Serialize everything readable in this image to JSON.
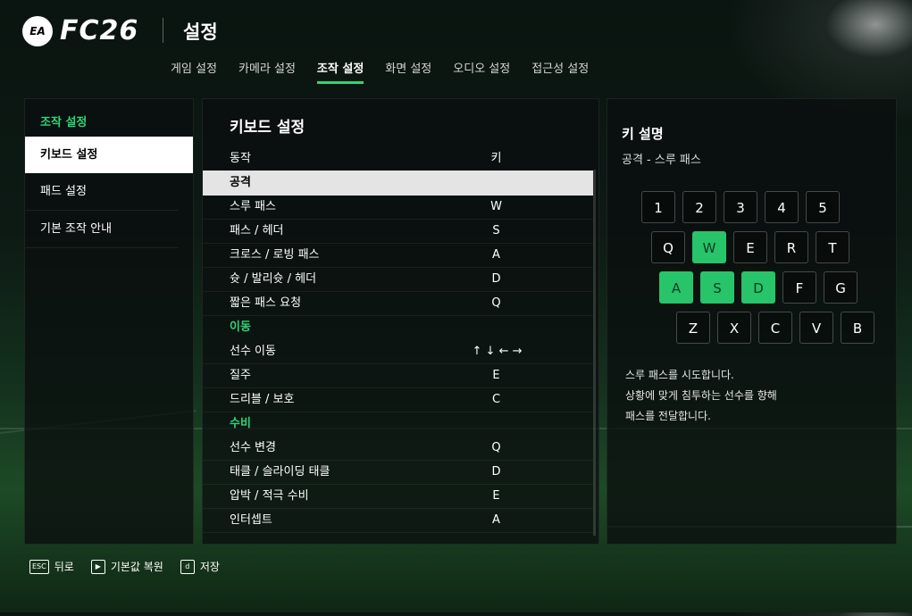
{
  "brand": {
    "ea": "EA",
    "game": "FC26"
  },
  "page_title": "설정",
  "tabs": [
    {
      "label": "게임 설정",
      "active": false
    },
    {
      "label": "카메라 설정",
      "active": false
    },
    {
      "label": "조작 설정",
      "active": true
    },
    {
      "label": "화면 설정",
      "active": false
    },
    {
      "label": "오디오 설정",
      "active": false
    },
    {
      "label": "접근성 설정",
      "active": false
    }
  ],
  "sidebar": {
    "header": "조작 설정",
    "items": [
      {
        "label": "키보드 설정",
        "selected": true
      },
      {
        "label": "패드 설정",
        "selected": false
      },
      {
        "label": "기본 조작 안내",
        "selected": false
      }
    ]
  },
  "keyboard": {
    "title": "키보드 설정",
    "col_action": "동작",
    "col_key": "키",
    "rows": [
      {
        "type": "section-item",
        "label": "공격",
        "key": "",
        "highlighted": true
      },
      {
        "type": "item",
        "label": "스루 패스",
        "key": "W"
      },
      {
        "type": "item",
        "label": "패스 / 헤더",
        "key": "S"
      },
      {
        "type": "item",
        "label": "크로스 / 로빙 패스",
        "key": "A"
      },
      {
        "type": "item",
        "label": "슛 / 발리슛 / 헤더",
        "key": "D"
      },
      {
        "type": "item",
        "label": "짧은 패스 요청",
        "key": "Q"
      },
      {
        "type": "section",
        "label": "이동"
      },
      {
        "type": "item",
        "label": "선수 이동",
        "key": "↑ ↓ ← →"
      },
      {
        "type": "item",
        "label": "질주",
        "key": "E"
      },
      {
        "type": "item",
        "label": "드리블 / 보호",
        "key": "C"
      },
      {
        "type": "section",
        "label": "수비"
      },
      {
        "type": "item",
        "label": "선수 변경",
        "key": "Q"
      },
      {
        "type": "item",
        "label": "태클 / 슬라이딩 태클",
        "key": "D"
      },
      {
        "type": "item",
        "label": "압박 / 적극 수비",
        "key": "E"
      },
      {
        "type": "item",
        "label": "인터셉트",
        "key": "A"
      }
    ]
  },
  "description": {
    "title": "키 설명",
    "subtitle": "공격 - 스루 패스",
    "lines": [
      "스루 패스를 시도합니다.",
      "상황에 맞게 침투하는 선수를 향해",
      "패스를 전달합니다."
    ]
  },
  "keymap": {
    "rows": [
      [
        "1",
        "2",
        "3",
        "4",
        "5"
      ],
      [
        "Q",
        "W",
        "E",
        "R",
        "T"
      ],
      [
        "A",
        "S",
        "D",
        "F",
        "G"
      ],
      [
        "Z",
        "X",
        "C",
        "V",
        "B"
      ]
    ],
    "active": [
      "W",
      "A",
      "S",
      "D"
    ]
  },
  "footer": [
    {
      "key": "ESC",
      "label": "뒤로"
    },
    {
      "key": "▶",
      "label": "기본값 복원"
    },
    {
      "key": "d",
      "label": "저장"
    }
  ],
  "colors": {
    "accent": "#2ed477",
    "active_key": "#27c46a"
  }
}
